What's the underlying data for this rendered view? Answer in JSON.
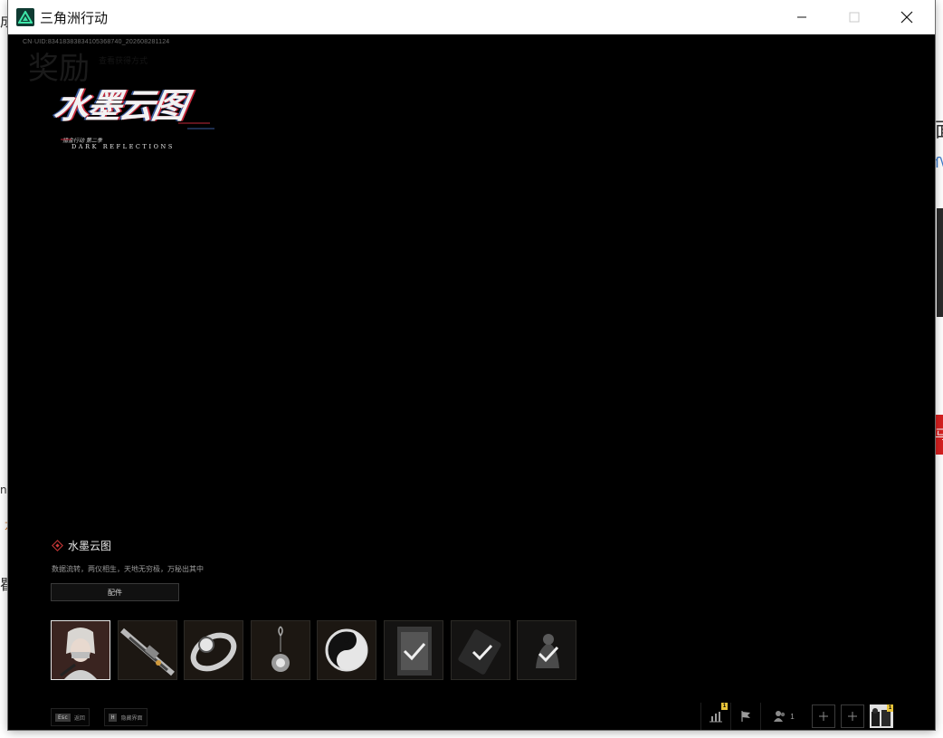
{
  "window": {
    "title": "三角洲行动",
    "controls": [
      "minimize",
      "maximize",
      "close"
    ]
  },
  "background_stubs": {
    "left_top": "成",
    "left_mid": "na",
    "left_low": "瞿",
    "left_dot": "方",
    "right_top": "面",
    "right_mid": "ſ\\",
    "right_red": "马"
  },
  "game": {
    "uid_line": "CN·UID:834183838341053687​40_202608281124",
    "page_title": "奖励",
    "page_subtitle": "查看获得方式",
    "logo": {
      "main": "水墨云图",
      "tiny": "猎金行动 第二季",
      "sub": "DARK REFLECTIONS"
    },
    "skin": {
      "name": "水墨云图",
      "description": "数据流转，两仪相生，天地无穷极，万秘出其中",
      "parts_button": "配件"
    },
    "items": [
      {
        "name": "operator-skin",
        "selected": true
      },
      {
        "name": "rifle-skin",
        "selected": false
      },
      {
        "name": "watch-pendant",
        "selected": false
      },
      {
        "name": "charm-pendant",
        "selected": false
      },
      {
        "name": "yin-yang-emblem",
        "selected": false
      },
      {
        "name": "card-checked",
        "selected": false
      },
      {
        "name": "device-checked",
        "selected": false
      },
      {
        "name": "figure-checked",
        "selected": false
      }
    ],
    "footer": {
      "hints": [
        {
          "key": "Esc",
          "label": "返回"
        },
        {
          "key": "H",
          "label": "隐藏界面"
        }
      ],
      "stats_badge": "1",
      "friends_count": "1",
      "avatar_badge": "1"
    }
  }
}
